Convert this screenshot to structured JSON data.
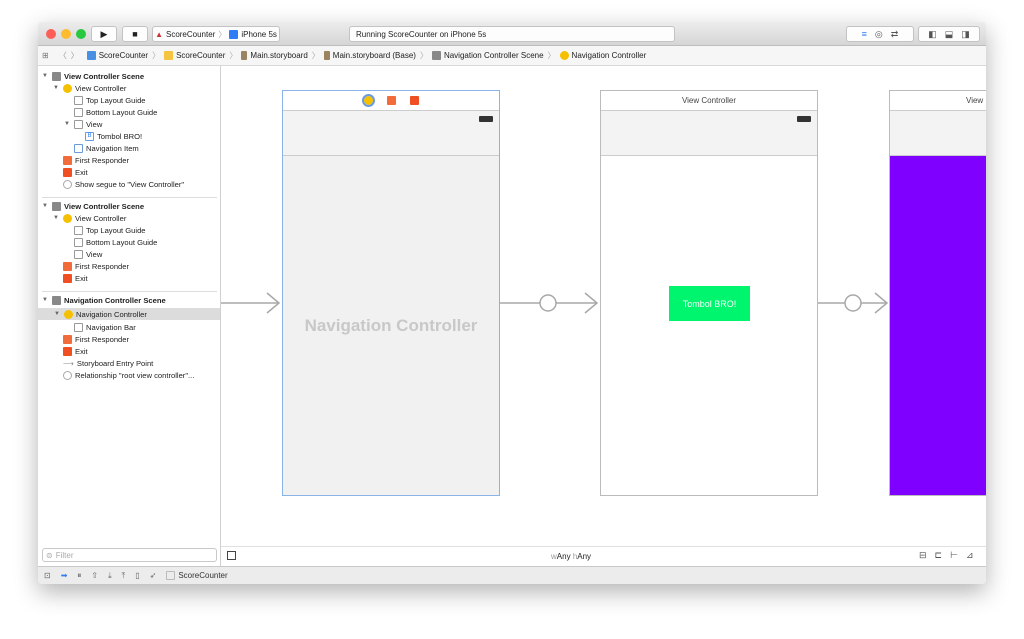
{
  "toolbar": {
    "scheme": "ScoreCounter",
    "device": "iPhone 5s",
    "status": "Running ScoreCounter on iPhone 5s"
  },
  "breadcrumb": [
    "ScoreCounter",
    "ScoreCounter",
    "Main.storyboard",
    "Main.storyboard (Base)",
    "Navigation Controller Scene",
    "Navigation Controller"
  ],
  "outline": {
    "scene1": {
      "title": "View Controller Scene",
      "vc": "View Controller",
      "top": "Top Layout Guide",
      "bottom": "Bottom Layout Guide",
      "view": "View",
      "button": "Tombol BRO!",
      "navitem": "Navigation Item",
      "responder": "First Responder",
      "exit": "Exit",
      "segue": "Show segue to \"View Controller\""
    },
    "scene2": {
      "title": "View Controller Scene",
      "vc": "View Controller",
      "top": "Top Layout Guide",
      "bottom": "Bottom Layout Guide",
      "view": "View",
      "responder": "First Responder",
      "exit": "Exit"
    },
    "scene3": {
      "title": "Navigation Controller Scene",
      "nc": "Navigation Controller",
      "navbar": "Navigation Bar",
      "responder": "First Responder",
      "exit": "Exit",
      "entry": "Storyboard Entry Point",
      "rel": "Relationship \"root view controller\"..."
    }
  },
  "filter_placeholder": "Filter",
  "canvas": {
    "nav_title": "Navigation Controller",
    "vc_title": "View Controller",
    "vc3_title": "View",
    "button": "Tombol BRO!",
    "size_w": "w",
    "size_w_val": "Any",
    "size_h": "h",
    "size_h_val": "Any"
  },
  "debug": {
    "target": "ScoreCounter"
  },
  "colors": {
    "button": "#00f56e",
    "purple": "#7f00ff",
    "accent": "#2f7cf6"
  }
}
